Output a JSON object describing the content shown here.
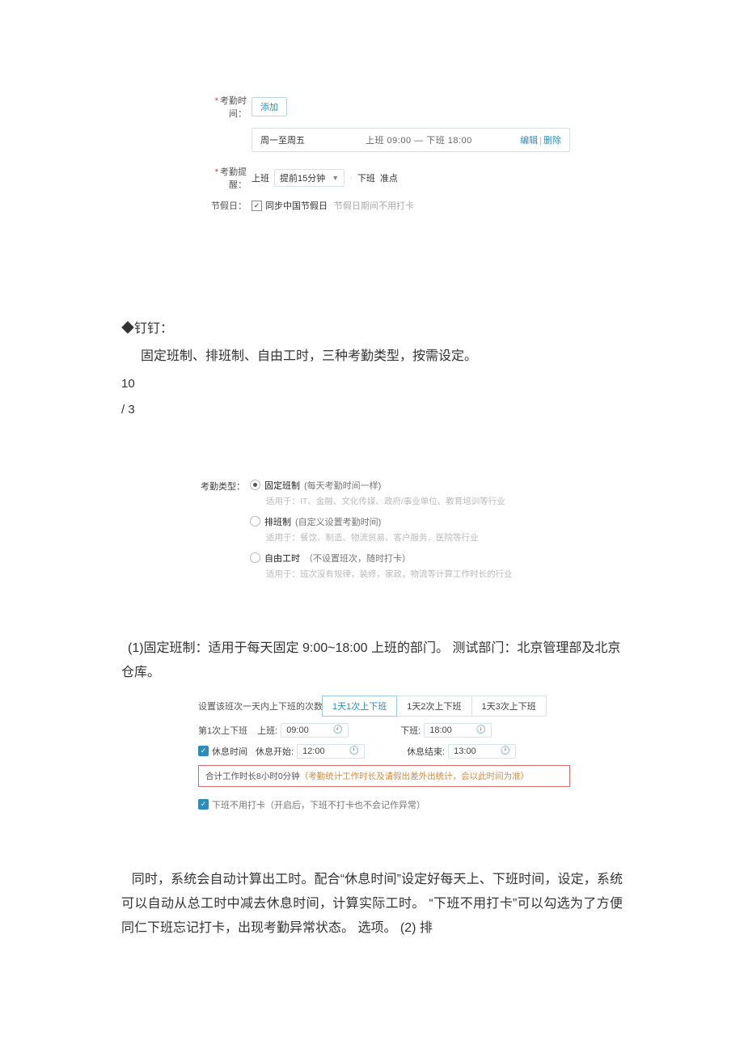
{
  "panel1": {
    "attendance_time_label": "考勤时间：",
    "add_button": "添加",
    "schedule": {
      "days": "周一至周五",
      "times": "上班 09:00  — 下班 18:00",
      "edit": "编辑",
      "delete": "删除"
    },
    "reminder_label": "考勤提醒：",
    "reminder_on_prefix": "上班",
    "reminder_before_select": "提前15分钟",
    "reminder_off_prefix": "下班",
    "reminder_off_value": "准点",
    "holiday_label": "节假日：",
    "holiday_checkbox": "同步中国节假日",
    "holiday_hint": "节假日期间不用打卡"
  },
  "body1": {
    "heading": "◆钉钉：",
    "line1": "固定班制、排班制、自由工时，三种考勤类型，按需设定。",
    "counter1": "10",
    "counter2": "/ 3"
  },
  "panel2": {
    "type_label": "考勤类型：",
    "options": [
      {
        "title": "固定班制",
        "paren": "(每天考勤时间一样)",
        "hint": "适用于：IT、金融、文化传媒、政府/事业单位、教育培训等行业",
        "checked": true
      },
      {
        "title": "排班制",
        "paren": "(自定义设置考勤时间)",
        "hint": "适用于：餐饮、制造、物流贸易、客户服务、医院等行业",
        "checked": false
      },
      {
        "title": "自由工时",
        "paren": "（不设置班次，随时打卡）",
        "hint": "适用于：班次没有规律，装修，家政，物流等计算工作时长的行业",
        "checked": false
      }
    ]
  },
  "body2": {
    "p1": "(1)固定班制：适用于每天固定 9:00~18:00 上班的部门。  测试部门：北京管理部及北京仓库。"
  },
  "panel3": {
    "freq_label": "设置该班次一天内上下班的次数",
    "tab1": "1天1次上下班",
    "tab2": "1天2次上下班",
    "tab3": "1天3次上下班",
    "row1_label": "第1次上下班",
    "on_label": "上班:",
    "on_value": "09:00",
    "off_label": "下班:",
    "off_value": "18:00",
    "rest_check_label": "休息时间",
    "rest_start_label": "休息开始:",
    "rest_start_value": "12:00",
    "rest_end_label": "休息结束:",
    "rest_end_value": "13:00",
    "sum_black": "合计工作时长8小时0分钟",
    "sum_orange": "（考勤统计工作时长及请假出差外出统计，会以此时间为准）",
    "noclock_label": "下班不用打卡（开启后，下班不打卡也不会记作异常）"
  },
  "body3": {
    "p1": "同时，系统会自动计算出工时。配合“休息时间”设定好每天上、下班时间，设定，系统可以自动从总工时中减去休息时间，计算实际工时。  “下班不用打卡”可以勾选为了方便同仁下班忘记打卡，出现考勤异常状态。  选项。  (2)  排"
  }
}
